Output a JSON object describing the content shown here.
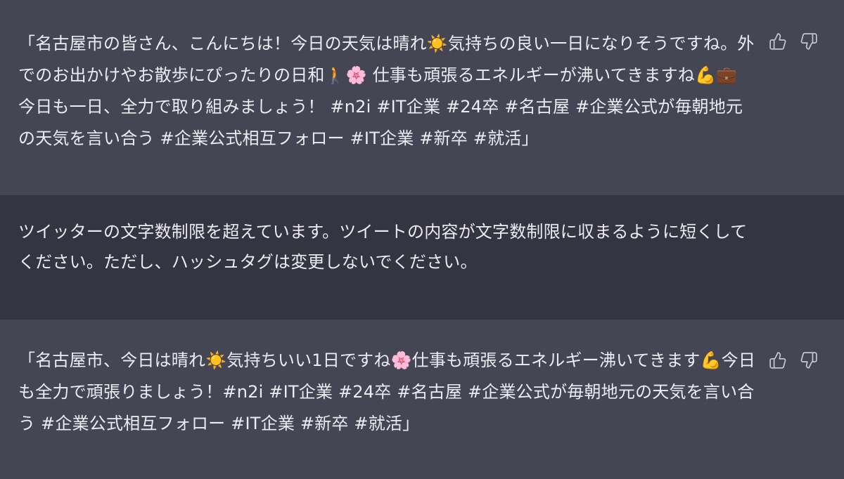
{
  "messages": [
    {
      "role": "assistant",
      "text": "「名古屋市の皆さん、こんにちは！今日の天気は晴れ☀️気持ちの良い一日になりそうですね。外でのお出かけやお散歩にぴったりの日和🚶🌸 仕事も頑張るエネルギーが沸いてきますね💪💼 今日も一日、全力で取り組みましょう！ #n2i #IT企業 #24卒 #名古屋 #企業公式が毎朝地元の天気を言い合う #企業公式相互フォロー #IT企業 #新卒 #就活」"
    },
    {
      "role": "user",
      "text": "ツイッターの文字数制限を超えています。ツイートの内容が文字数制限に収まるように短くしてください。ただし、ハッシュタグは変更しないでください。"
    },
    {
      "role": "assistant",
      "text": "「名古屋市、今日は晴れ☀️気持ちいい1日ですね🌸仕事も頑張るエネルギー沸いてきます💪今日も全力で頑張りましょう！#n2i #IT企業 #24卒 #名古屋 #企業公式が毎朝地元の天気を言い合う #企業公式相互フォロー #IT企業 #新卒 #就活」"
    }
  ],
  "icons": {
    "thumbs_up": "thumbs-up-icon",
    "thumbs_down": "thumbs-down-icon"
  },
  "colors": {
    "assistant_bg": "#444654",
    "user_bg": "#343541",
    "text": "#ececf1",
    "icon": "#c5c5d2"
  }
}
